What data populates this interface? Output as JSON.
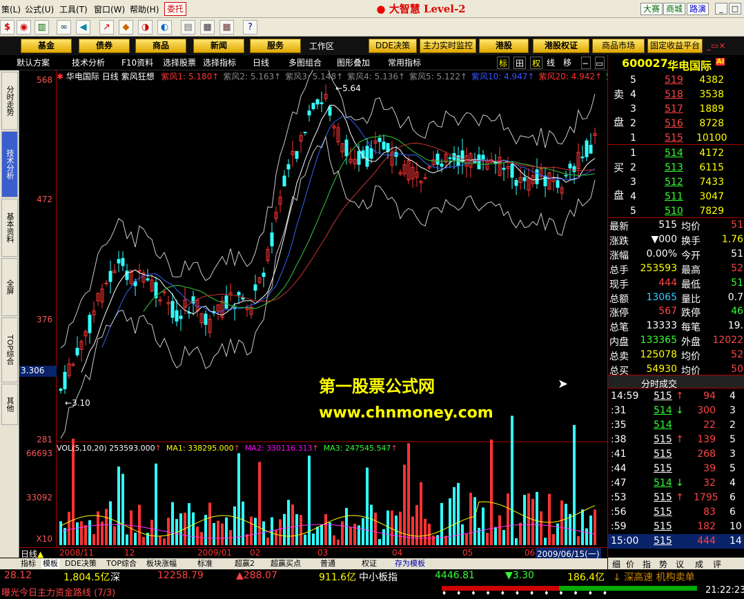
{
  "menu": {
    "items": [
      "策(L)",
      "公式(U)",
      "工具(T)",
      "窗口(W)",
      "帮助(H)"
    ],
    "entrust": "委托",
    "title": "大智慧 Level-2",
    "quick": [
      "大赛",
      "商城",
      "路演"
    ]
  },
  "funcbar": {
    "items": [
      "基金",
      "债券",
      "商品",
      "新闻",
      "服务",
      "工作区",
      "DDE决策",
      "主力实时监控",
      "港股",
      "港股权证",
      "商品市场",
      "固定收益平台"
    ]
  },
  "tabs": [
    "默认方案",
    "技术分析",
    "F10资料",
    "选择股票",
    "选择指标",
    "日线",
    "多图组合",
    "图形叠加",
    "常用指标"
  ],
  "tab_icons": [
    "标",
    "田",
    "权",
    "线",
    "移"
  ],
  "leftnav": [
    "分时走势",
    "技术分析",
    "基本资料",
    "全屏",
    "TOP综合",
    "其他"
  ],
  "yaxis": {
    "main": [
      "568",
      "472",
      "376",
      "281"
    ],
    "vol": [
      "66693",
      "33092",
      "X10"
    ],
    "cursor": "3.306"
  },
  "chart": {
    "header": {
      "name": "华电国际",
      "period": "日线",
      "indicator": "紫风狂想",
      "lines": [
        {
          "label": "紫风1:",
          "value": "5.180",
          "color": "#ff3333"
        },
        {
          "label": "紫风2:",
          "value": "5.163",
          "color": "#888888"
        },
        {
          "label": "紫风3:",
          "value": "5.148",
          "color": "#888888"
        },
        {
          "label": "紫风4:",
          "value": "5.136",
          "color": "#888888"
        },
        {
          "label": "紫风5:",
          "value": "5.122",
          "color": "#888888"
        },
        {
          "label": "紫风10:",
          "value": "4.947",
          "color": "#3355ff"
        },
        {
          "label": "紫风20:",
          "value": "4.942",
          "color": "#ff3333"
        },
        {
          "label": "紫",
          "value": "",
          "color": "#33cc33"
        }
      ]
    },
    "annot_high": "5.64",
    "annot_low": "3.10",
    "vol_header": {
      "label": "VOL(5,10,20)",
      "value": "253593.000",
      "ma1": "MA1: 338295.000",
      "ma2": "MA2: 330116.313",
      "ma3": "MA3: 247545.547"
    },
    "watermark1": "第一股票公式网",
    "watermark2": "www.chnmoney.com"
  },
  "datebar": {
    "period": "日线",
    "dates": [
      "2008/11",
      "12",
      "2009/01",
      "02",
      "03",
      "04",
      "05",
      "06"
    ],
    "current": "2009/06/15(一)"
  },
  "btabs": [
    "指标",
    "模板",
    "DDE决策",
    "TOP综合",
    "板块涨幅",
    "标准",
    "超赢2",
    "超赢买点",
    "普通",
    "权证",
    "存为模板"
  ],
  "quote": {
    "code": "600027",
    "name": "华电国际",
    "badge": "AI",
    "sell": [
      {
        "lv": "5",
        "p": "519",
        "v": "4382"
      },
      {
        "lv": "4",
        "p": "518",
        "v": "3538"
      },
      {
        "lv": "3",
        "p": "517",
        "v": "1889"
      },
      {
        "lv": "2",
        "p": "516",
        "v": "8728"
      },
      {
        "lv": "1",
        "p": "515",
        "v": "10100"
      }
    ],
    "buy": [
      {
        "lv": "1",
        "p": "514",
        "v": "4172"
      },
      {
        "lv": "2",
        "p": "513",
        "v": "6115"
      },
      {
        "lv": "3",
        "p": "512",
        "v": "7433"
      },
      {
        "lv": "4",
        "p": "511",
        "v": "3047"
      },
      {
        "lv": "5",
        "p": "510",
        "v": "7829"
      }
    ],
    "sell_label": [
      "卖",
      "盘"
    ],
    "buy_label": [
      "买",
      "盘"
    ],
    "stats": [
      {
        "l1": "最新",
        "v1": "515",
        "c1": "#fff",
        "l2": "均价",
        "v2": "51",
        "c2": "#ff4444"
      },
      {
        "l1": "涨跌",
        "v1": "▼000",
        "c1": "#fff",
        "l2": "换手",
        "v2": "1.76",
        "c2": "#ffff00"
      },
      {
        "l1": "涨幅",
        "v1": "0.00%",
        "c1": "#fff",
        "l2": "今开",
        "v2": "51",
        "c2": "#fff"
      },
      {
        "l1": "总手",
        "v1": "253593",
        "c1": "#ffff00",
        "l2": "最高",
        "v2": "52",
        "c2": "#ff4444"
      },
      {
        "l1": "现手",
        "v1": "444",
        "c1": "#ff4444",
        "l2": "最低",
        "v2": "51",
        "c2": "#33ff33"
      },
      {
        "l1": "总额",
        "v1": "13065",
        "c1": "#3cf",
        "l2": "量比",
        "v2": "0.7",
        "c2": "#fff"
      },
      {
        "l1": "涨停",
        "v1": "567",
        "c1": "#ff4444",
        "l2": "跌停",
        "v2": "46",
        "c2": "#33ff33"
      },
      {
        "l1": "总笔",
        "v1": "13333",
        "c1": "#fff",
        "l2": "每笔",
        "v2": "19.",
        "c2": "#fff"
      },
      {
        "l1": "内盘",
        "v1": "133365",
        "c1": "#33ff33",
        "l2": "外盘",
        "v2": "12022",
        "c2": "#ff4444"
      },
      {
        "l1": "总卖",
        "v1": "125078",
        "c1": "#ffff00",
        "l2": "均价",
        "v2": "52",
        "c2": "#ff4444"
      },
      {
        "l1": "总买",
        "v1": "54930",
        "c1": "#ffff00",
        "l2": "均价",
        "v2": "50",
        "c2": "#ff4444"
      }
    ],
    "ticks_header": "分时成交",
    "ticks": [
      {
        "t": "14:59",
        "p": "515",
        "a": "↑",
        "v": "94",
        "n": "4",
        "pc": "#fff",
        "vc": "#ff4444"
      },
      {
        "t": ":31",
        "p": "514",
        "a": "↓",
        "v": "300",
        "n": "3",
        "pc": "#33ff33",
        "vc": "#ff4444"
      },
      {
        "t": ":35",
        "p": "514",
        "a": "",
        "v": "22",
        "n": "2",
        "pc": "#33ff33",
        "vc": "#ff4444"
      },
      {
        "t": ":38",
        "p": "515",
        "a": "↑",
        "v": "139",
        "n": "5",
        "pc": "#fff",
        "vc": "#ff4444"
      },
      {
        "t": ":41",
        "p": "515",
        "a": "",
        "v": "268",
        "n": "3",
        "pc": "#fff",
        "vc": "#ff4444"
      },
      {
        "t": ":44",
        "p": "515",
        "a": "",
        "v": "39",
        "n": "5",
        "pc": "#fff",
        "vc": "#ff4444"
      },
      {
        "t": ":47",
        "p": "514",
        "a": "↓",
        "v": "32",
        "n": "4",
        "pc": "#33ff33",
        "vc": "#ff4444"
      },
      {
        "t": ":53",
        "p": "515",
        "a": "↑",
        "v": "1795",
        "n": "6",
        "pc": "#fff",
        "vc": "#ff4444"
      },
      {
        "t": ":56",
        "p": "515",
        "a": "",
        "v": "83",
        "n": "6",
        "pc": "#fff",
        "vc": "#ff4444"
      },
      {
        "t": ":59",
        "p": "515",
        "a": "",
        "v": "182",
        "n": "10",
        "pc": "#fff",
        "vc": "#ff4444"
      },
      {
        "t": "15:00",
        "p": "515",
        "a": "",
        "v": "444",
        "n": "14",
        "pc": "#fff",
        "vc": "#ff4444"
      }
    ],
    "bottom_tabs": [
      "细",
      "价",
      "指",
      "势",
      "议",
      "成",
      "评"
    ]
  },
  "indexbar": {
    "i1": "28.12",
    "i2": "1,804.5亿",
    "i3": "深",
    "i4": "12258.79",
    "i5": "▲288.07",
    "i6": "911.6亿",
    "i7": "中小板指",
    "i8": "4446.81",
    "i9": "▼3.30",
    "i10": "186.4亿",
    "i11": "深高速 机构卖单"
  },
  "statusbar": {
    "text": "曝光今日主力资金路线 (7/3)",
    "time": "21:22:23"
  },
  "colors": {
    "up": "#ff3333",
    "down": "#33ffff",
    "ma5": "#ffffff",
    "ma10": "#3366ff",
    "ma20": "#33aa33",
    "brand": "#e6a800"
  }
}
